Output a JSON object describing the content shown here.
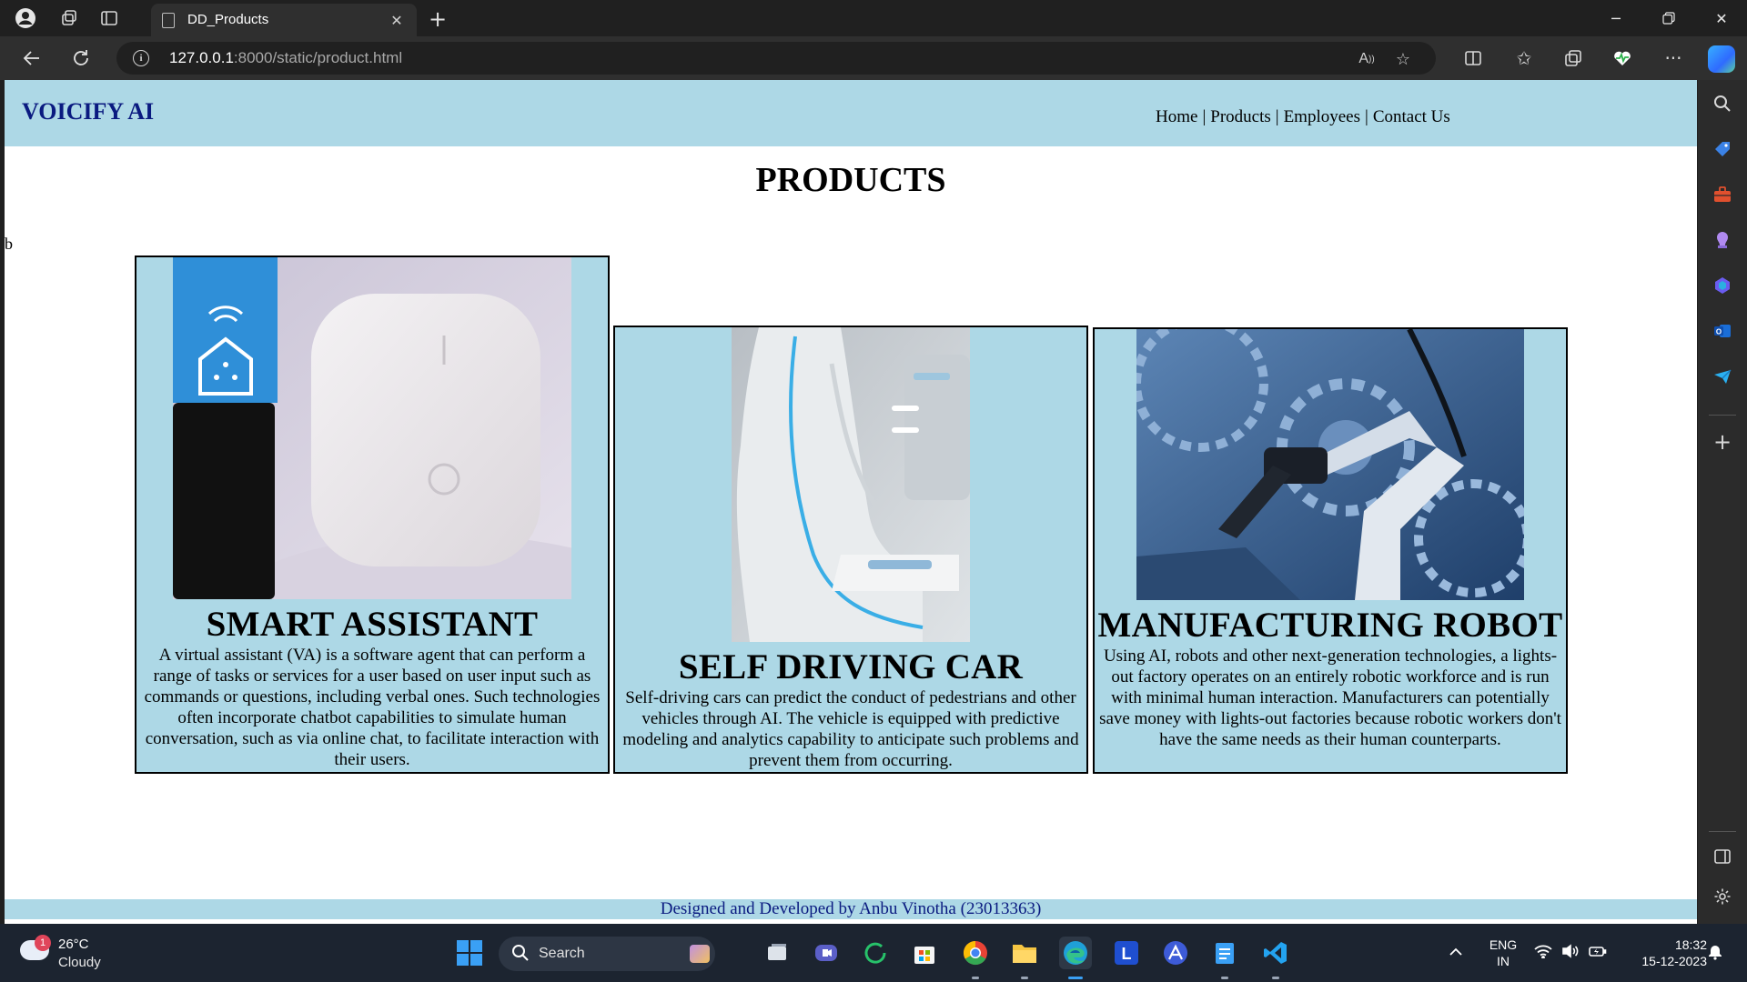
{
  "browser": {
    "tab_title": "DD_Products",
    "url_host": "127.0.0.1",
    "url_path": ":8000/static/product.html"
  },
  "site": {
    "logo": "VOICIFY AI",
    "nav": [
      "Home",
      "Products",
      "Employees",
      "Contact Us"
    ],
    "nav_separator": "|",
    "page_title": "PRODUCTS",
    "stray_text": "b",
    "footer": "Designed and Developed by Anbu Vinotha (23013363)"
  },
  "products": [
    {
      "title": "SMART ASSISTANT",
      "description": "A virtual assistant (VA) is a software agent that can perform a range of tasks or services for a user based on user input such as commands or questions, including verbal ones. Such technologies often incorporate chatbot capabilities to simulate human conversation, such as via online chat, to facilitate interaction with their users."
    },
    {
      "title": "SELF DRIVING CAR",
      "description": "Self-driving cars can predict the conduct of pedestrians and other vehicles through AI. The vehicle is equipped with predictive modeling and analytics capability to anticipate such problems and prevent them from occurring."
    },
    {
      "title": "MANUFACTURING ROBOT",
      "description": "Using AI, robots and other next-generation technologies, a lights-out factory operates on an entirely robotic workforce and is run with minimal human interaction. Manufacturers can potentially save money with lights-out factories because robotic workers don't have the same needs as their human counterparts."
    }
  ],
  "taskbar": {
    "weather_temp": "26°C",
    "weather_desc": "Cloudy",
    "weather_badge": "1",
    "search_label": "Search",
    "lang_top": "ENG",
    "lang_bottom": "IN",
    "time": "18:32",
    "date": "15-12-2023"
  },
  "colors": {
    "header_bg": "#add8e6",
    "logo_color": "#0a1a80",
    "footer_text": "#0a1a80"
  }
}
